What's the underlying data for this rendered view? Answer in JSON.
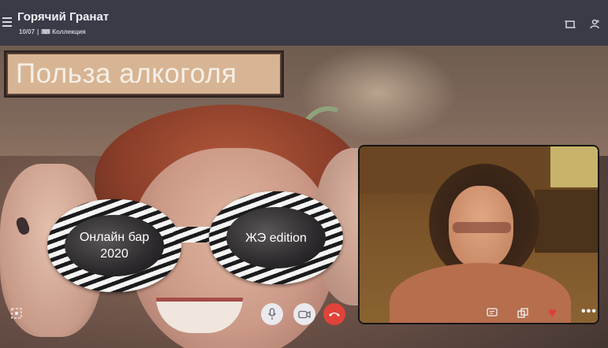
{
  "header": {
    "title": "Горячий Гранат",
    "participants": "10/07",
    "collection": "Коллекция",
    "icons": [
      "menu-icon",
      "layout-icon",
      "add-person-icon"
    ]
  },
  "caption": {
    "text": "Польза алкоголя"
  },
  "glasses": {
    "left_lens_text_line1": "Онлайн бар",
    "left_lens_text_line2": "2020",
    "right_lens_text": "ЖЭ edition"
  },
  "controls": {
    "icons": [
      "screenshot-icon",
      "microphone-icon",
      "video-camera-icon",
      "end-call-icon",
      "chat-icon",
      "switch-camera-icon",
      "heart-icon",
      "more-options-icon"
    ],
    "end_call_color": "#e0433a",
    "heart_color": "#e23a3a"
  }
}
